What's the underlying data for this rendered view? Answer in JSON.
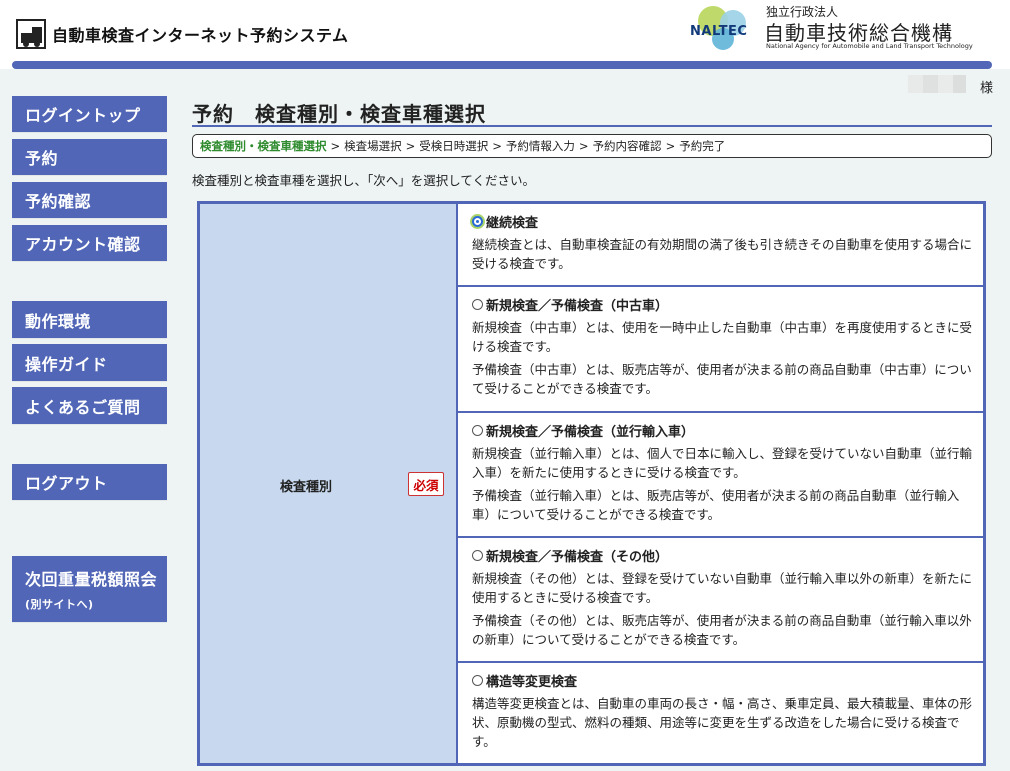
{
  "header": {
    "app_title": "自動車検査インターネット予約システム",
    "org_logo_text": "NALTEC",
    "org_subtitle": "独立行政法人",
    "org_name": "自動車技術総合機構",
    "org_name_en": "National Agency for Automobile and Land Transport Technology"
  },
  "user": {
    "suffix": "様"
  },
  "sidebar": {
    "items": [
      {
        "label": "ログイントップ"
      },
      {
        "label": "予約"
      },
      {
        "label": "予約確認"
      },
      {
        "label": "アカウント確認"
      },
      {
        "label": "動作環境"
      },
      {
        "label": "操作ガイド"
      },
      {
        "label": "よくあるご質問"
      },
      {
        "label": "ログアウト"
      },
      {
        "label": "次回重量税額照会",
        "sub": "(別サイトへ)"
      }
    ]
  },
  "main": {
    "title": "予約　検査種別・検査車種選択",
    "breadcrumb": [
      "検査種別・検査車種選択",
      "検査場選択",
      "受検日時選択",
      "予約情報入力",
      "予約内容確認",
      "予約完了"
    ],
    "breadcrumb_sep": ">",
    "instruction": "検査種別と検査車種を選択し、「次へ」を選択してください。",
    "form": {
      "field_label": "検査種別",
      "required_label": "必須",
      "options": [
        {
          "label": "継続検査",
          "checked": true,
          "desc1": "継続検査とは、自動車検査証の有効期間の満了後も引き続きその自動車を使用する場合に受ける検査です。",
          "desc2": ""
        },
        {
          "label": "新規検査／予備検査（中古車）",
          "checked": false,
          "desc1": "新規検査（中古車）とは、使用を一時中止した自動車（中古車）を再度使用するときに受ける検査です。",
          "desc2": "予備検査（中古車）とは、販売店等が、使用者が決まる前の商品自動車（中古車）について受けることができる検査です。"
        },
        {
          "label": "新規検査／予備検査（並行輸入車）",
          "checked": false,
          "desc1": "新規検査（並行輸入車）とは、個人で日本に輸入し、登録を受けていない自動車（並行輸入車）を新たに使用するときに受ける検査です。",
          "desc2": "予備検査（並行輸入車）とは、販売店等が、使用者が決まる前の商品自動車（並行輸入車）について受けることができる検査です。"
        },
        {
          "label": "新規検査／予備検査（その他）",
          "checked": false,
          "desc1": "新規検査（その他）とは、登録を受けていない自動車（並行輸入車以外の新車）を新たに使用するときに受ける検査です。",
          "desc2": "予備検査（その他）とは、販売店等が、使用者が決まる前の商品自動車（並行輸入車以外の新車）について受けることができる検査です。"
        },
        {
          "label": "構造等変更検査",
          "checked": false,
          "desc1": "構造等変更検査とは、自動車の車両の長さ・幅・高さ、乗車定員、最大積載量、車体の形状、原動機の型式、燃料の種類、用途等に変更を生ずる改造をした場合に受ける検査です。",
          "desc2": ""
        }
      ]
    }
  },
  "colors": {
    "nav_bg": "#5166b6",
    "label_cell_bg": "#c8d8ee",
    "breadcrumb_active": "#2e8b2e",
    "required_red": "#cc0000"
  }
}
